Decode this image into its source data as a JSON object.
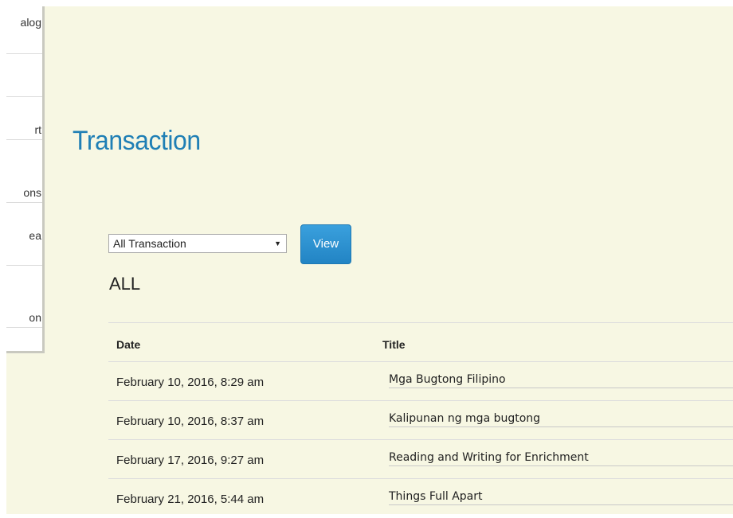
{
  "sidebar": {
    "items": [
      {
        "label": "alog"
      },
      {
        "label": ""
      },
      {
        "label": "rt"
      },
      {
        "label": "ons"
      },
      {
        "label": "ea"
      },
      {
        "label": "on"
      }
    ]
  },
  "page": {
    "title": "Transaction"
  },
  "filter": {
    "selected": "All Transaction",
    "view_label": "View",
    "heading": "ALL"
  },
  "table": {
    "columns": [
      "Date",
      "Title"
    ],
    "rows": [
      {
        "date": "February 10, 2016, 8:29 am",
        "title": "Mga Bugtong Filipino"
      },
      {
        "date": "February 10, 2016, 8:37 am",
        "title": "Kalipunan ng mga bugtong"
      },
      {
        "date": "February 17, 2016, 9:27 am",
        "title": "Reading and Writing for Enrichment"
      },
      {
        "date": "February 21, 2016, 5:44 am",
        "title": "Things Full Apart"
      }
    ]
  },
  "colors": {
    "background": "#f7f7e3",
    "title": "#1f7fb5",
    "button": "#2a8fce"
  }
}
